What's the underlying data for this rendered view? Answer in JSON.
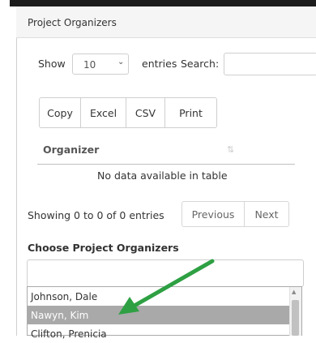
{
  "panel": {
    "title": "Project Organizers"
  },
  "length_control": {
    "show_label": "Show",
    "selected": "10",
    "entries_label": "entries"
  },
  "search": {
    "label": "Search:",
    "value": ""
  },
  "export_buttons": [
    "Copy",
    "Excel",
    "CSV",
    "Print"
  ],
  "table": {
    "columns": [
      "Organizer"
    ],
    "empty_message": "No data available in table"
  },
  "info": "Showing 0 to 0 of 0 entries",
  "pagination": {
    "previous": "Previous",
    "next": "Next"
  },
  "chooser": {
    "label": "Choose Project Organizers",
    "input_value": "",
    "options": [
      "Johnson, Dale",
      "Nawyn, Kim",
      "Clifton, Prenicia"
    ],
    "highlighted": "Nawyn, Kim"
  },
  "colors": {
    "arrow": "#2ea043",
    "highlight": "#a9a9a9"
  },
  "icons": {
    "sort": "sort-icon",
    "select": "chevron-down-icon",
    "arrow": "annotation-arrow"
  }
}
